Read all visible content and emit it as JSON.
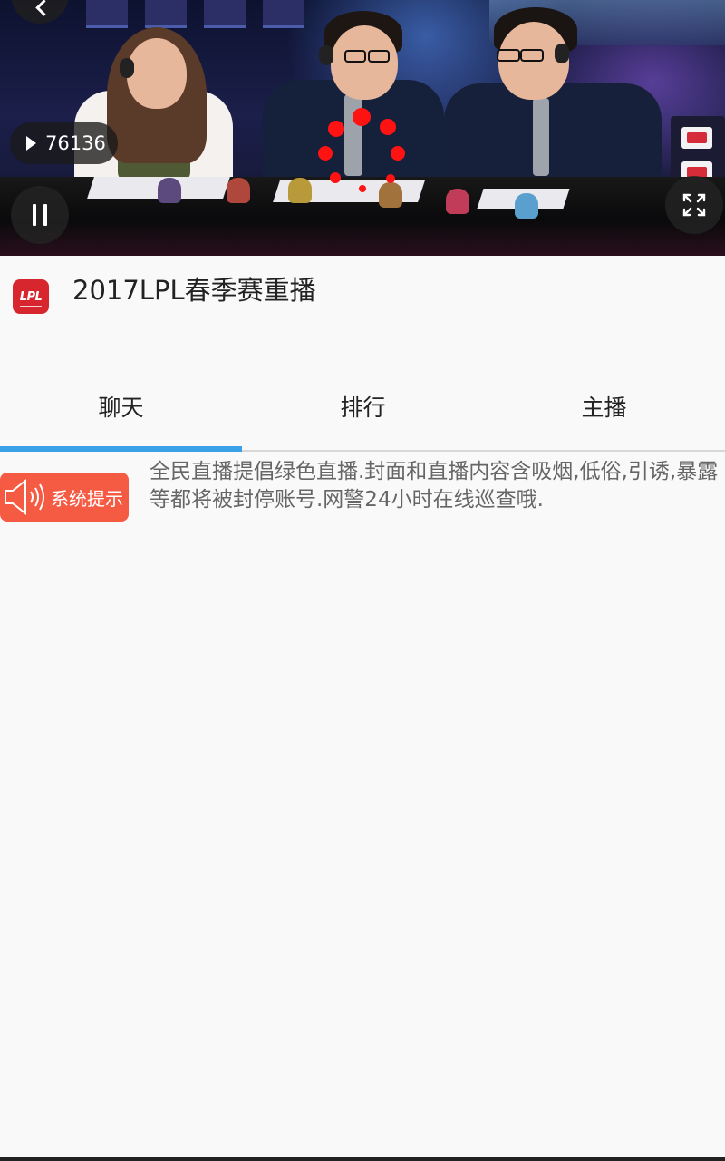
{
  "video": {
    "view_count": "76136",
    "icons": {
      "play": "play-icon",
      "pause": "pause-icon",
      "fullscreen": "fullscreen-icon",
      "back": "back-icon"
    },
    "loading_color": "#ff1212"
  },
  "channel": {
    "logo_text": "LPL",
    "title": "2017LPL春季赛重播"
  },
  "tabs": [
    {
      "label": "聊天",
      "active": true
    },
    {
      "label": "排行",
      "active": false
    },
    {
      "label": "主播",
      "active": false
    }
  ],
  "notice": {
    "badge_label": "系统提示",
    "badge_icon": "speaker-icon",
    "text": "全民直播提倡绿色直播.封面和直播内容含吸烟,低俗,引诱,暴露等都将被封停账号.网警24小时在线巡查哦."
  },
  "colors": {
    "accent": "#3aa1e8",
    "notice_badge": "#f55a43",
    "logo": "#d8262f"
  }
}
